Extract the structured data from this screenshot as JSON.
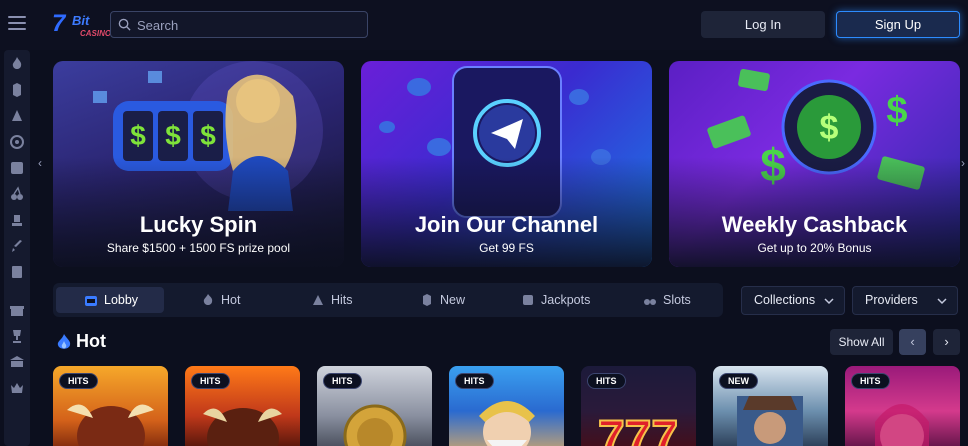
{
  "header": {
    "logo": {
      "number": "7",
      "word": "Bit",
      "sub": "CASINO"
    },
    "search": {
      "placeholder": "Search",
      "icon": "search-icon"
    },
    "login_label": "Log In",
    "signup_label": "Sign Up"
  },
  "sidebar": {
    "icons": [
      "flame-icon",
      "cards-icon",
      "poker-chips-icon",
      "target-icon",
      "dice-icon",
      "cherries-icon",
      "podium-icon",
      "rocket-icon",
      "card-deck-icon",
      "gift-icon",
      "trophy-icon",
      "bank-icon",
      "crown-icon"
    ]
  },
  "banners": [
    {
      "title": "Lucky Spin",
      "subtitle": "Share $1500 + 1500 FS prize pool"
    },
    {
      "title": "Join Our Channel",
      "subtitle": "Get 99 FS"
    },
    {
      "title": "Weekly Cashback",
      "subtitle": "Get up to 20% Bonus"
    }
  ],
  "tabs": [
    {
      "label": "Lobby",
      "icon": "slot-machine-icon",
      "active": true
    },
    {
      "label": "Hot",
      "icon": "flame-icon"
    },
    {
      "label": "Hits",
      "icon": "cards-icon"
    },
    {
      "label": "New",
      "icon": "poker-chips-icon"
    },
    {
      "label": "Jackpots",
      "icon": "dice-icon"
    },
    {
      "label": "Slots",
      "icon": "cherries-icon"
    }
  ],
  "filters": {
    "collections_label": "Collections",
    "providers_label": "Providers"
  },
  "hot_section": {
    "title": "Hot",
    "show_all_label": "Show All",
    "prev_icon": "chevron-left-icon",
    "next_icon": "chevron-right-icon",
    "games": [
      {
        "badge": "HITS"
      },
      {
        "badge": "HITS"
      },
      {
        "badge": "HITS"
      },
      {
        "badge": "HITS"
      },
      {
        "badge": "HITS"
      },
      {
        "badge": "NEW"
      },
      {
        "badge": "HITS"
      }
    ]
  },
  "colors": {
    "background": "#0c0f1e",
    "accent": "#2d8cff",
    "panel": "#141a2e"
  }
}
